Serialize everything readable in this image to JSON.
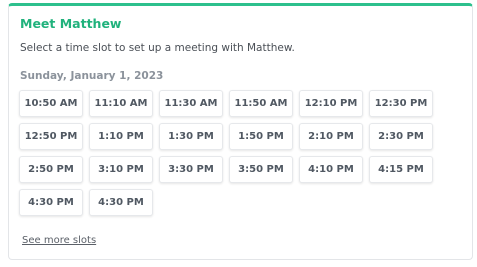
{
  "card": {
    "title": "Meet Matthew",
    "subtitle": "Select a time slot to set up a meeting with Matthew.",
    "date": "Sunday, January 1, 2023",
    "see_more_label": "See more slots"
  },
  "slots": [
    "10:50 AM",
    "11:10 AM",
    "11:30 AM",
    "11:50 AM",
    "12:10 PM",
    "12:30 PM",
    "12:50 PM",
    "1:10 PM",
    "1:30 PM",
    "1:50 PM",
    "2:10 PM",
    "2:30 PM",
    "2:50 PM",
    "3:10 PM",
    "3:30 PM",
    "3:50 PM",
    "4:10 PM",
    "4:15 PM",
    "4:30 PM",
    "4:30 PM"
  ],
  "colors": {
    "accent": "#2dc08d",
    "title": "#20b27c"
  }
}
